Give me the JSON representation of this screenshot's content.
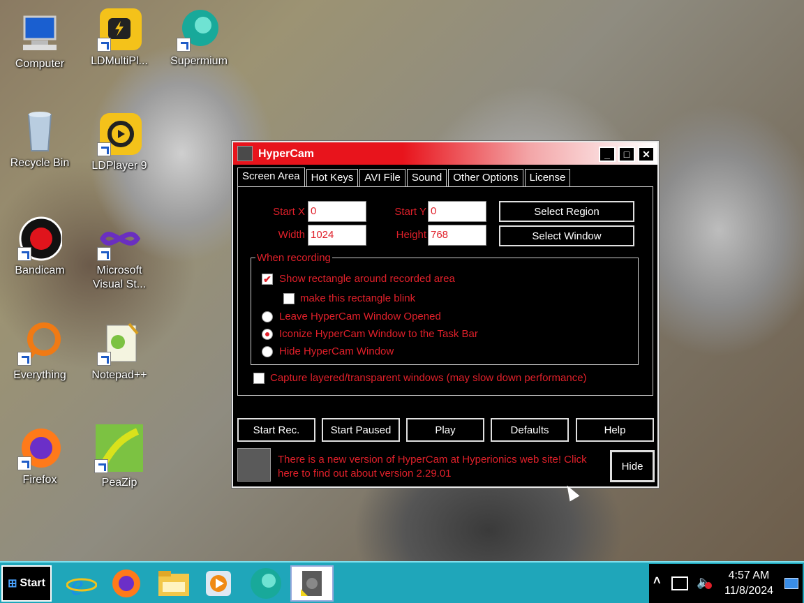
{
  "desktop": {
    "icons": [
      {
        "label": "Computer",
        "icon": "computer-icon"
      },
      {
        "label": "LDMultiPl...",
        "icon": "ldmultiplayer-icon"
      },
      {
        "label": "Supermium",
        "icon": "supermium-icon"
      },
      {
        "label": "Recycle Bin",
        "icon": "recycle-bin-icon"
      },
      {
        "label": "LDPlayer 9",
        "icon": "ldplayer-icon"
      },
      {
        "label": "Bandicam",
        "icon": "bandicam-icon"
      },
      {
        "label": "Microsoft Visual St...",
        "icon": "visual-studio-icon"
      },
      {
        "label": "Everything",
        "icon": "everything-icon"
      },
      {
        "label": "Notepad++",
        "icon": "notepadpp-icon"
      },
      {
        "label": "Firefox",
        "icon": "firefox-icon"
      },
      {
        "label": "PeaZip",
        "icon": "peazip-icon"
      }
    ]
  },
  "window": {
    "title": "HyperCam",
    "controls": {
      "minimize": "_",
      "maximize": "□",
      "close": "✕"
    },
    "tabs": [
      "Screen Area",
      "Hot Keys",
      "AVI File",
      "Sound",
      "Other Options",
      "License"
    ],
    "fields": {
      "start_x_label": "Start X",
      "start_x_value": "0",
      "start_y_label": "Start Y",
      "start_y_value": "0",
      "width_label": "Width",
      "width_value": "1024",
      "height_label": "Height",
      "height_value": "768"
    },
    "buttons": {
      "select_region": "Select Region",
      "select_window": "Select Window"
    },
    "group_title": "When recording",
    "options": {
      "show_rect": "Show rectangle around recorded area",
      "blink_rect": "make this rectangle blink",
      "leave_open": "Leave HyperCam Window Opened",
      "iconize": "Iconize HyperCam Window to the Task Bar",
      "hide": "Hide HyperCam Window",
      "capture_layered": "Capture layered/transparent windows (may slow down performance)"
    },
    "states": {
      "show_rect": true,
      "blink_rect": false,
      "radio_selected": "iconize",
      "capture_layered": false
    },
    "bottom_buttons": [
      "Start Rec.",
      "Start Paused",
      "Play",
      "Defaults",
      "Help"
    ],
    "notice": "There is a new version of HyperCam at Hyperionics web site! Click here to find out about version 2.29.01",
    "hide_button": "Hide"
  },
  "taskbar": {
    "start_label": "Start",
    "time": "4:57 AM",
    "date": "11/8/2024",
    "tray_arrow": "˄"
  }
}
